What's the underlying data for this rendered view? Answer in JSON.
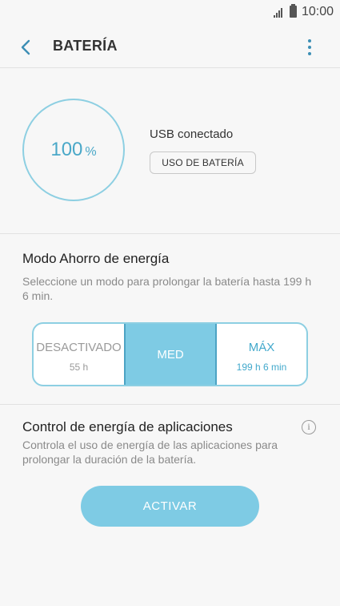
{
  "status_bar": {
    "time": "10:00",
    "signal_icon": "signal-icon",
    "battery_icon": "battery-icon"
  },
  "header": {
    "title": "BATERÍA",
    "back_icon": "chevron-left-icon",
    "more_icon": "more-vertical-icon"
  },
  "battery": {
    "percent_value": "100",
    "percent_unit": "%",
    "level_fraction": 1.0,
    "usb_status": "USB conectado",
    "usage_button_label": "USO DE BATERÍA"
  },
  "power_mode": {
    "title": "Modo Ahorro de energía",
    "description": "Seleccione un modo para prolongar la batería hasta 199 h 6 min.",
    "options": [
      {
        "label": "DESACTIVADO",
        "sub": "55 h"
      },
      {
        "label": "MED",
        "sub": ""
      },
      {
        "label": "MÁX",
        "sub": "199 h 6 min"
      }
    ],
    "selected": "MED"
  },
  "app_power": {
    "title": "Control de energía de aplicaciones",
    "description": "Controla el uso de energía de las aplicaciones para prolongar la duración de la batería.",
    "info_icon": "info-icon",
    "activate_label": "ACTIVAR"
  },
  "colors": {
    "accent": "#7ecbe4",
    "accent_dark": "#43a9cc",
    "background": "#f7f7f7"
  }
}
